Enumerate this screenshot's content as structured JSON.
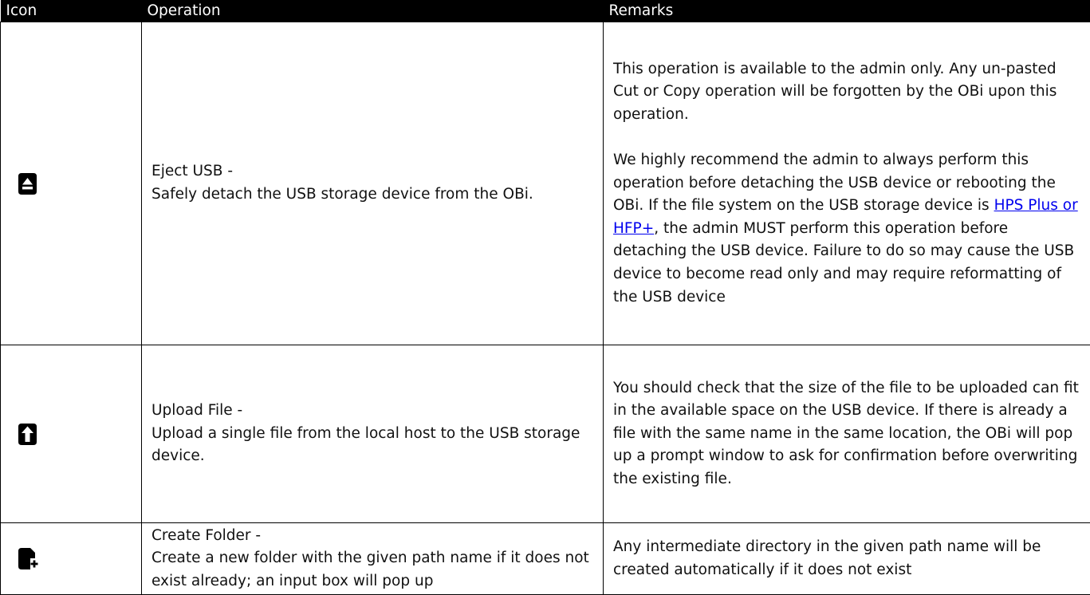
{
  "header": {
    "col_icon": "Icon",
    "col_operation": "Operation",
    "col_remarks": "Remarks"
  },
  "rows": [
    {
      "icon": "eject-icon",
      "op_title": "Eject USB -",
      "op_desc": "Safely detach the USB storage device from the OBi.",
      "remark_p1": "This operation is available to the admin only. Any un-pasted Cut or Copy operation will be forgotten by the OBi upon this operation.",
      "remark_p2_before": "We highly recommend the admin to always perform this operation before detaching the USB device or rebooting the OBi. If the file system on the USB storage device is ",
      "remark_p2_link": "HPS Plus or HFP+",
      "remark_p2_after": ", the admin MUST perform this operation before detaching the USB device. Failure to do so may cause the USB device to become read only and may require reformatting of the USB device"
    },
    {
      "icon": "upload-icon",
      "op_title": "Upload File -",
      "op_desc": "Upload a single file from the local host to the USB storage device.",
      "remark": "You should check that the size of the file to be uploaded can fit in the available space on the USB device. If there is already a file with the same name in the same location, the OBi will pop up a prompt window to ask for confirmation before overwriting the existing file."
    },
    {
      "icon": "create-folder-icon",
      "op_title": "Create Folder -",
      "op_desc": "Create a new folder with the given path name if it does not exist already; an input box will pop up",
      "remark": "Any intermediate directory in the given path name will be created automatically if it does not exist"
    }
  ],
  "colors": {
    "header_bg": "#000000",
    "header_text": "#ffffff",
    "link": "#0000ee",
    "icon": "#000000"
  }
}
